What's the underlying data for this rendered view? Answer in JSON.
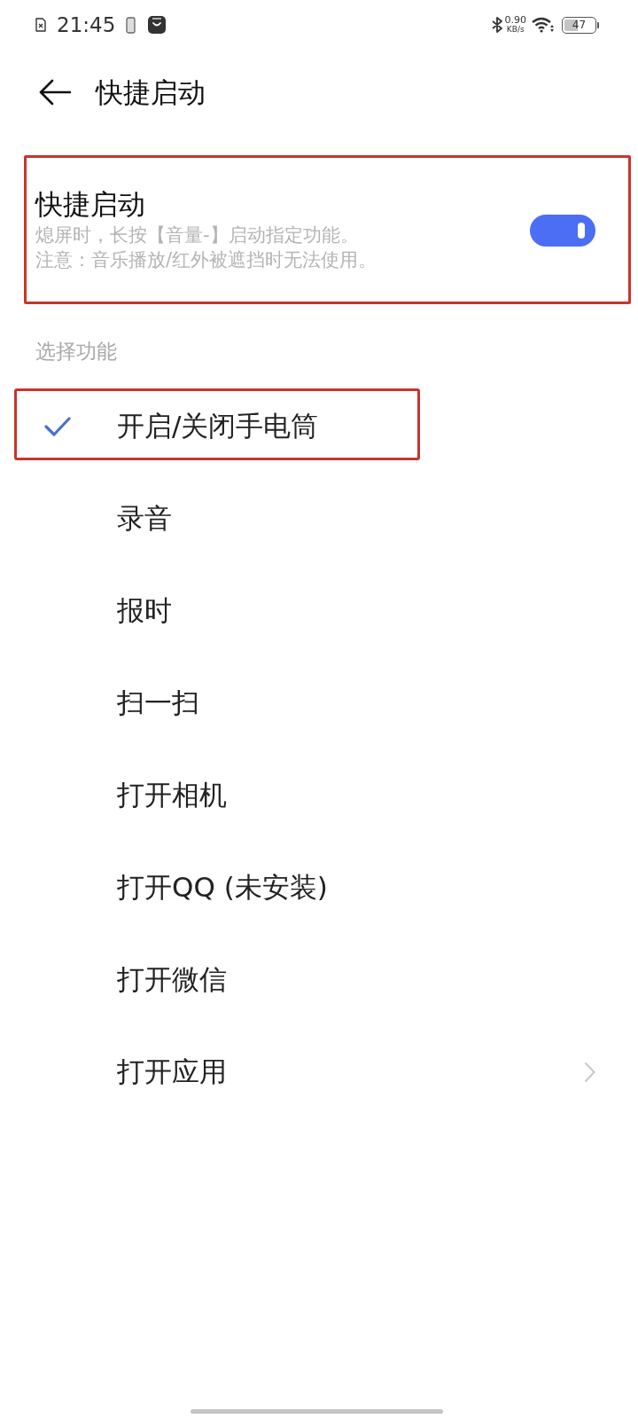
{
  "status_bar": {
    "time": "21:45",
    "speed": "0.90",
    "speed_unit": "KB/s",
    "battery": "47"
  },
  "header": {
    "title": "快捷启动"
  },
  "quick_launch": {
    "title": "快捷启动",
    "description": [
      "熄屏时，长按【音量-】启动指定功能。",
      "注意：音乐播放/红外被遮挡时无法使用。"
    ],
    "on": true,
    "highlighted": true
  },
  "section_label": "选择功能",
  "functions": [
    {
      "label": "开启/关闭手电筒",
      "kind": "option",
      "selected": true,
      "highlighted": true
    },
    {
      "label": "录音",
      "kind": "option",
      "selected": false,
      "highlighted": false
    },
    {
      "label": "报时",
      "kind": "option",
      "selected": false,
      "highlighted": false
    },
    {
      "label": "扫一扫",
      "kind": "option",
      "selected": false,
      "highlighted": false
    },
    {
      "label": "打开相机",
      "kind": "option",
      "selected": false,
      "highlighted": false
    },
    {
      "label": "打开QQ (未安装)",
      "kind": "option",
      "selected": false,
      "highlighted": false
    },
    {
      "label": "打开微信",
      "kind": "option",
      "selected": false,
      "highlighted": false
    },
    {
      "label": "打开应用",
      "kind": "submenu",
      "selected": false,
      "highlighted": false
    }
  ]
}
